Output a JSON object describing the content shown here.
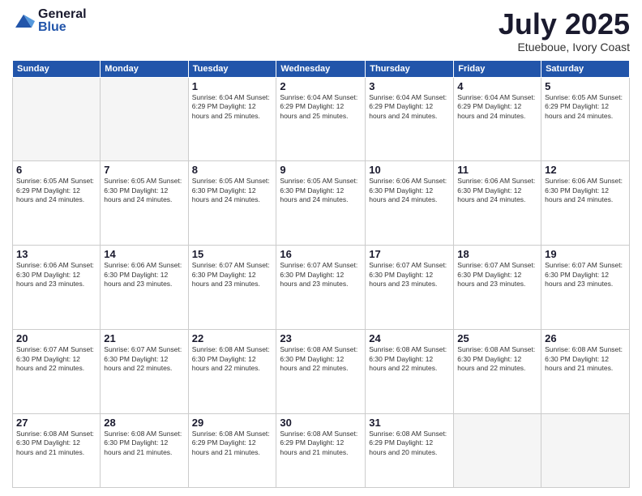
{
  "logo": {
    "general": "General",
    "blue": "Blue"
  },
  "header": {
    "month": "July 2025",
    "location": "Etueboue, Ivory Coast"
  },
  "weekdays": [
    "Sunday",
    "Monday",
    "Tuesday",
    "Wednesday",
    "Thursday",
    "Friday",
    "Saturday"
  ],
  "weeks": [
    [
      {
        "day": "",
        "detail": ""
      },
      {
        "day": "",
        "detail": ""
      },
      {
        "day": "1",
        "detail": "Sunrise: 6:04 AM\nSunset: 6:29 PM\nDaylight: 12 hours and 25 minutes."
      },
      {
        "day": "2",
        "detail": "Sunrise: 6:04 AM\nSunset: 6:29 PM\nDaylight: 12 hours and 25 minutes."
      },
      {
        "day": "3",
        "detail": "Sunrise: 6:04 AM\nSunset: 6:29 PM\nDaylight: 12 hours and 24 minutes."
      },
      {
        "day": "4",
        "detail": "Sunrise: 6:04 AM\nSunset: 6:29 PM\nDaylight: 12 hours and 24 minutes."
      },
      {
        "day": "5",
        "detail": "Sunrise: 6:05 AM\nSunset: 6:29 PM\nDaylight: 12 hours and 24 minutes."
      }
    ],
    [
      {
        "day": "6",
        "detail": "Sunrise: 6:05 AM\nSunset: 6:29 PM\nDaylight: 12 hours and 24 minutes."
      },
      {
        "day": "7",
        "detail": "Sunrise: 6:05 AM\nSunset: 6:30 PM\nDaylight: 12 hours and 24 minutes."
      },
      {
        "day": "8",
        "detail": "Sunrise: 6:05 AM\nSunset: 6:30 PM\nDaylight: 12 hours and 24 minutes."
      },
      {
        "day": "9",
        "detail": "Sunrise: 6:05 AM\nSunset: 6:30 PM\nDaylight: 12 hours and 24 minutes."
      },
      {
        "day": "10",
        "detail": "Sunrise: 6:06 AM\nSunset: 6:30 PM\nDaylight: 12 hours and 24 minutes."
      },
      {
        "day": "11",
        "detail": "Sunrise: 6:06 AM\nSunset: 6:30 PM\nDaylight: 12 hours and 24 minutes."
      },
      {
        "day": "12",
        "detail": "Sunrise: 6:06 AM\nSunset: 6:30 PM\nDaylight: 12 hours and 24 minutes."
      }
    ],
    [
      {
        "day": "13",
        "detail": "Sunrise: 6:06 AM\nSunset: 6:30 PM\nDaylight: 12 hours and 23 minutes."
      },
      {
        "day": "14",
        "detail": "Sunrise: 6:06 AM\nSunset: 6:30 PM\nDaylight: 12 hours and 23 minutes."
      },
      {
        "day": "15",
        "detail": "Sunrise: 6:07 AM\nSunset: 6:30 PM\nDaylight: 12 hours and 23 minutes."
      },
      {
        "day": "16",
        "detail": "Sunrise: 6:07 AM\nSunset: 6:30 PM\nDaylight: 12 hours and 23 minutes."
      },
      {
        "day": "17",
        "detail": "Sunrise: 6:07 AM\nSunset: 6:30 PM\nDaylight: 12 hours and 23 minutes."
      },
      {
        "day": "18",
        "detail": "Sunrise: 6:07 AM\nSunset: 6:30 PM\nDaylight: 12 hours and 23 minutes."
      },
      {
        "day": "19",
        "detail": "Sunrise: 6:07 AM\nSunset: 6:30 PM\nDaylight: 12 hours and 23 minutes."
      }
    ],
    [
      {
        "day": "20",
        "detail": "Sunrise: 6:07 AM\nSunset: 6:30 PM\nDaylight: 12 hours and 22 minutes."
      },
      {
        "day": "21",
        "detail": "Sunrise: 6:07 AM\nSunset: 6:30 PM\nDaylight: 12 hours and 22 minutes."
      },
      {
        "day": "22",
        "detail": "Sunrise: 6:08 AM\nSunset: 6:30 PM\nDaylight: 12 hours and 22 minutes."
      },
      {
        "day": "23",
        "detail": "Sunrise: 6:08 AM\nSunset: 6:30 PM\nDaylight: 12 hours and 22 minutes."
      },
      {
        "day": "24",
        "detail": "Sunrise: 6:08 AM\nSunset: 6:30 PM\nDaylight: 12 hours and 22 minutes."
      },
      {
        "day": "25",
        "detail": "Sunrise: 6:08 AM\nSunset: 6:30 PM\nDaylight: 12 hours and 22 minutes."
      },
      {
        "day": "26",
        "detail": "Sunrise: 6:08 AM\nSunset: 6:30 PM\nDaylight: 12 hours and 21 minutes."
      }
    ],
    [
      {
        "day": "27",
        "detail": "Sunrise: 6:08 AM\nSunset: 6:30 PM\nDaylight: 12 hours and 21 minutes."
      },
      {
        "day": "28",
        "detail": "Sunrise: 6:08 AM\nSunset: 6:30 PM\nDaylight: 12 hours and 21 minutes."
      },
      {
        "day": "29",
        "detail": "Sunrise: 6:08 AM\nSunset: 6:29 PM\nDaylight: 12 hours and 21 minutes."
      },
      {
        "day": "30",
        "detail": "Sunrise: 6:08 AM\nSunset: 6:29 PM\nDaylight: 12 hours and 21 minutes."
      },
      {
        "day": "31",
        "detail": "Sunrise: 6:08 AM\nSunset: 6:29 PM\nDaylight: 12 hours and 20 minutes."
      },
      {
        "day": "",
        "detail": ""
      },
      {
        "day": "",
        "detail": ""
      }
    ]
  ]
}
